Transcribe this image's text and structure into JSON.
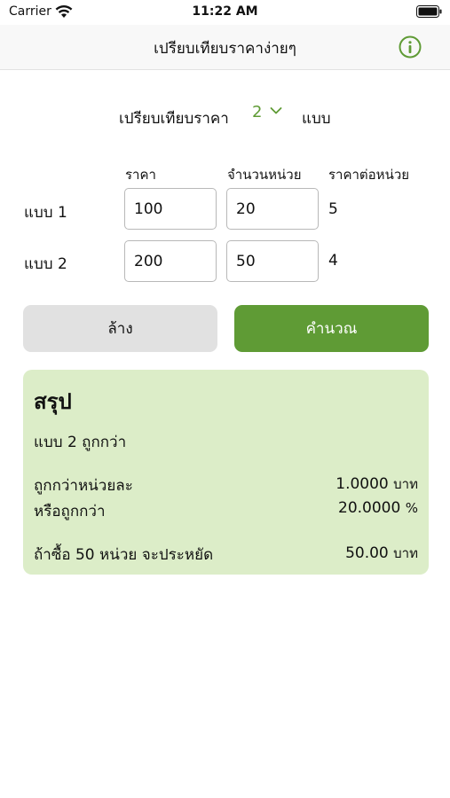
{
  "status_bar": {
    "carrier": "Carrier",
    "time": "11:22 AM"
  },
  "nav": {
    "title": "เปรียบเทียบราคาง่ายๆ",
    "info_icon": "info-circle-icon"
  },
  "compare": {
    "label": "เปรียบเทียบราคา",
    "count": "2",
    "unit": "แบบ"
  },
  "columns": {
    "price": "ราคา",
    "quantity": "จำนวนหน่วย",
    "price_per_unit": "ราคาต่อหน่วย"
  },
  "options": [
    {
      "label": "แบบ 1",
      "price": "100",
      "quantity": "20",
      "price_per_unit": "5"
    },
    {
      "label": "แบบ 2",
      "price": "200",
      "quantity": "50",
      "price_per_unit": "4"
    }
  ],
  "buttons": {
    "clear": "ล้าง",
    "calculate": "คำนวณ"
  },
  "summary": {
    "title": "สรุป",
    "winner": "แบบ 2 ถูกกว่า",
    "cheaper_per_unit_label": "ถูกกว่าหน่วยละ",
    "cheaper_per_unit_value": "1.0000",
    "cheaper_per_unit_unit": "บาท",
    "cheaper_percent_label": "หรือถูกกว่า",
    "cheaper_percent_value": "20.0000",
    "cheaper_percent_unit": "%",
    "savings_label": "ถ้าซื้อ 50 หน่วย จะประหยัด",
    "savings_value": "50.00",
    "savings_unit": "บาท"
  },
  "colors": {
    "accent": "#5f9b35",
    "summary_bg": "#dcedc8",
    "clear_bg": "#e1e1e1"
  }
}
